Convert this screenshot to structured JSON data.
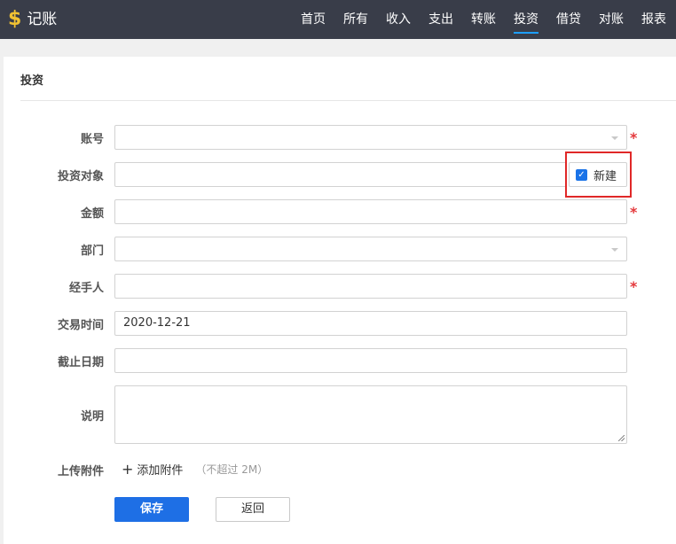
{
  "header": {
    "brand_icon": "$",
    "brand_title": "记账",
    "nav": [
      "首页",
      "所有",
      "收入",
      "支出",
      "转账",
      "投资",
      "借贷",
      "对账",
      "报表"
    ],
    "active_nav": "投资"
  },
  "panel": {
    "title": "投资"
  },
  "form": {
    "account_label": "账号",
    "target_label": "投资对象",
    "amount_label": "金额",
    "department_label": "部门",
    "handler_label": "经手人",
    "trade_time_label": "交易时间",
    "trade_time_value": "2020-12-21",
    "deadline_label": "截止日期",
    "note_label": "说明",
    "upload_label": "上传附件",
    "new_checkbox_label": "新建",
    "new_checked": true,
    "required_mark": "*"
  },
  "attachment": {
    "add_label": "添加附件",
    "limit_note": "（不超过 2M）"
  },
  "buttons": {
    "save": "保存",
    "back": "返回"
  },
  "colors": {
    "topbar": "#393d49",
    "accent": "#1e6fe5",
    "required": "#e4393c",
    "highlight": "#e02828"
  }
}
